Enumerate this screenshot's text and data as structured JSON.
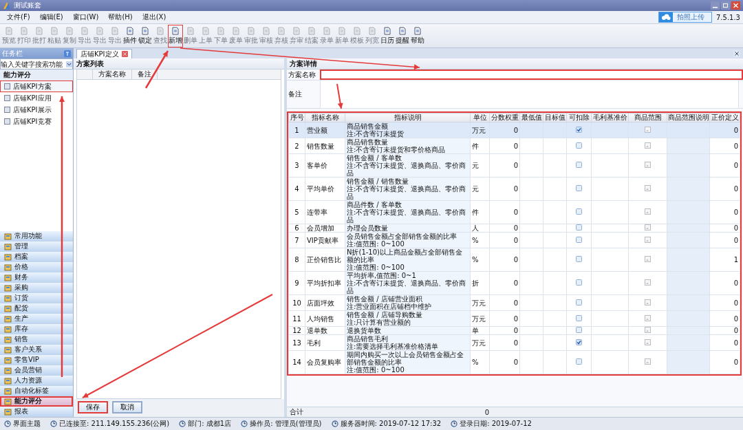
{
  "window": {
    "title": "测试账套",
    "upload_button": "拍照上传",
    "version": "7.5.1.3"
  },
  "menu": [
    "文件(F)",
    "编辑(E)",
    "窗口(W)",
    "帮助(H)",
    "退出(X)"
  ],
  "toolbar": [
    {
      "label": "预览",
      "disabled": true,
      "highlighted": false
    },
    {
      "label": "打印",
      "disabled": true,
      "highlighted": false
    },
    {
      "label": "批打",
      "disabled": true,
      "highlighted": false
    },
    {
      "label": "粘贴",
      "disabled": true,
      "highlighted": false
    },
    {
      "label": "复制",
      "disabled": true,
      "highlighted": false
    },
    {
      "label": "导出",
      "disabled": true,
      "highlighted": false
    },
    {
      "label": "导出",
      "disabled": true,
      "highlighted": false
    },
    {
      "label": "导出",
      "disabled": true,
      "highlighted": false
    },
    {
      "label": "插件",
      "disabled": false,
      "highlighted": false
    },
    {
      "label": "锁定",
      "disabled": false,
      "highlighted": false
    },
    {
      "label": "查找",
      "disabled": true,
      "highlighted": false
    },
    {
      "label": "新增",
      "disabled": false,
      "highlighted": true
    },
    {
      "label": "删单",
      "disabled": true,
      "highlighted": false
    },
    {
      "label": "上单",
      "disabled": true,
      "highlighted": false
    },
    {
      "label": "下单",
      "disabled": true,
      "highlighted": false
    },
    {
      "label": "废单",
      "disabled": true,
      "highlighted": false
    },
    {
      "label": "审批",
      "disabled": true,
      "highlighted": false
    },
    {
      "label": "审核",
      "disabled": true,
      "highlighted": false
    },
    {
      "label": "弃核",
      "disabled": true,
      "highlighted": false
    },
    {
      "label": "弃审",
      "disabled": true,
      "highlighted": false
    },
    {
      "label": "结案",
      "disabled": true,
      "highlighted": false
    },
    {
      "label": "录单",
      "disabled": true,
      "highlighted": false
    },
    {
      "label": "新单",
      "disabled": true,
      "highlighted": false
    },
    {
      "label": "模板",
      "disabled": true,
      "highlighted": false
    },
    {
      "label": "列宽",
      "disabled": true,
      "highlighted": false
    },
    {
      "label": "日历",
      "disabled": false,
      "highlighted": false
    },
    {
      "label": "提醒",
      "disabled": false,
      "highlighted": false
    },
    {
      "label": "帮助",
      "disabled": false,
      "highlighted": false
    }
  ],
  "sidebar": {
    "title": "任务栏",
    "search_placeholder": "输入关键字搜索功能",
    "group": "能力评分",
    "items": [
      {
        "label": "店铺KPI方案",
        "selected": true,
        "highlighted": true
      },
      {
        "label": "店铺KPI应用",
        "selected": false,
        "highlighted": false
      },
      {
        "label": "店铺KPI展示",
        "selected": false,
        "highlighted": false
      },
      {
        "label": "店铺KPI竞赛",
        "selected": false,
        "highlighted": false
      }
    ],
    "modules": [
      {
        "label": "常用功能",
        "selected": false,
        "highlighted": false
      },
      {
        "label": "管理",
        "selected": false,
        "highlighted": false
      },
      {
        "label": "档案",
        "selected": false,
        "highlighted": false
      },
      {
        "label": "价格",
        "selected": false,
        "highlighted": false
      },
      {
        "label": "财务",
        "selected": false,
        "highlighted": false
      },
      {
        "label": "采购",
        "selected": false,
        "highlighted": false
      },
      {
        "label": "订货",
        "selected": false,
        "highlighted": false
      },
      {
        "label": "配货",
        "selected": false,
        "highlighted": false
      },
      {
        "label": "生产",
        "selected": false,
        "highlighted": false
      },
      {
        "label": "库存",
        "selected": false,
        "highlighted": false
      },
      {
        "label": "销售",
        "selected": false,
        "highlighted": false
      },
      {
        "label": "客户关系",
        "selected": false,
        "highlighted": false
      },
      {
        "label": "零售VIP",
        "selected": false,
        "highlighted": false
      },
      {
        "label": "会员营销",
        "selected": false,
        "highlighted": false
      },
      {
        "label": "人力资源",
        "selected": false,
        "highlighted": false
      },
      {
        "label": "自动化标签",
        "selected": false,
        "highlighted": false
      },
      {
        "label": "能力评分",
        "selected": true,
        "highlighted": true
      },
      {
        "label": "报表",
        "selected": false,
        "highlighted": false
      }
    ]
  },
  "tab": {
    "label": "店铺KPI定义"
  },
  "plan_list": {
    "title": "方案列表",
    "columns": [
      "方案名称",
      "备注"
    ],
    "buttons": [
      {
        "label": "保存",
        "highlighted": true
      },
      {
        "label": "取消",
        "highlighted": false
      }
    ]
  },
  "plan_detail": {
    "title": "方案详情",
    "name_label": "方案名称",
    "name_highlighted": true,
    "remark_label": "备注"
  },
  "table": {
    "highlighted": true,
    "columns": [
      "序号",
      "指标名称",
      "指标说明",
      "单位",
      "分数权重",
      "最低值",
      "目标值",
      "可扣除",
      "毛利基准价",
      "商品范围",
      "商品范围说明",
      "正价定义"
    ],
    "rows": [
      {
        "no": "1",
        "name": "营业额",
        "desc": [
          "商品销售金额",
          "注:不含寄订未提货"
        ],
        "unit": "万元",
        "weight": "0",
        "deductible": true,
        "regular": "0",
        "selected": true
      },
      {
        "no": "2",
        "name": "销售数量",
        "desc": [
          "商品销售数量",
          "注:不含寄订未提货和零价格商品"
        ],
        "unit": "件",
        "weight": "0",
        "deductible": false,
        "regular": "0",
        "selected": false
      },
      {
        "no": "3",
        "name": "客单价",
        "desc": [
          "销售金额 / 客单数",
          "注:不含寄订未提货、退换商品、零价商品"
        ],
        "unit": "元",
        "weight": "0",
        "deductible": false,
        "regular": "0",
        "selected": false
      },
      {
        "no": "4",
        "name": "平均单价",
        "desc": [
          "销售金额 / 销售数量",
          "注:不含寄订未提货、退换商品、零价商品"
        ],
        "unit": "元",
        "weight": "0",
        "deductible": false,
        "regular": "0",
        "selected": false
      },
      {
        "no": "5",
        "name": "连带率",
        "desc": [
          "商品件数 / 客单数",
          "注:不含寄订未提货、退换商品、零价商品"
        ],
        "unit": "件",
        "weight": "0",
        "deductible": false,
        "regular": "0",
        "selected": false
      },
      {
        "no": "6",
        "name": "会员增加",
        "desc": [
          "办理会员数量"
        ],
        "unit": "人",
        "weight": "0",
        "deductible": false,
        "regular": "0",
        "selected": false
      },
      {
        "no": "7",
        "name": "VIP贡献率",
        "desc": [
          "会员销售金额占全部销售金额的比率",
          "注:值范围: 0~100"
        ],
        "unit": "%",
        "weight": "0",
        "deductible": false,
        "regular": "0",
        "selected": false
      },
      {
        "no": "8",
        "name": "正价销售比",
        "desc": [
          "N折(1-10)以上商品金额占全部销售金额的比率",
          "注:值范围: 0~100"
        ],
        "unit": "%",
        "weight": "0",
        "deductible": false,
        "regular": "1",
        "selected": false
      },
      {
        "no": "9",
        "name": "平均折扣率",
        "desc": [
          "平均折率,值范围: 0~1",
          "注:不含寄订未提货、退换商品、零价商品"
        ],
        "unit": "折",
        "weight": "0",
        "deductible": false,
        "regular": "0",
        "selected": false
      },
      {
        "no": "10",
        "name": "店面坪效",
        "desc": [
          "销售金额 / 店铺营业面积",
          "注:营业面积在店铺档中维护"
        ],
        "unit": "万元",
        "weight": "0",
        "deductible": false,
        "regular": "0",
        "selected": false
      },
      {
        "no": "11",
        "name": "人均销售",
        "desc": [
          "销售金额 / 店铺导购数量",
          "注:只计算有营业额的"
        ],
        "unit": "万元",
        "weight": "0",
        "deductible": false,
        "regular": "0",
        "selected": false
      },
      {
        "no": "12",
        "name": "退单数",
        "desc": [
          "退换货单数"
        ],
        "unit": "单",
        "weight": "0",
        "deductible": false,
        "regular": "0",
        "selected": false
      },
      {
        "no": "13",
        "name": "毛利",
        "desc": [
          "商品销售毛利",
          "注:需要选择毛利基准价格清单"
        ],
        "unit": "万元",
        "weight": "0",
        "deductible": true,
        "regular": "0",
        "selected": false
      },
      {
        "no": "14",
        "name": "会员复购率",
        "desc": [
          "期间内购买一次以上会员销售金额占全部销售金额的比率",
          "注:值范围: 0~100"
        ],
        "unit": "%",
        "weight": "0",
        "deductible": false,
        "regular": "0",
        "selected": false
      }
    ],
    "total_label": "合计",
    "total": "0"
  },
  "status_bar": [
    "界面主题",
    "已连接至: 211.149.155.236(公网)",
    "部门: 成都1店",
    "操作员: 管理员(管理员)",
    "服务器时间: 2019-07-12 17:32",
    "登录日期: 2019-07-12"
  ]
}
